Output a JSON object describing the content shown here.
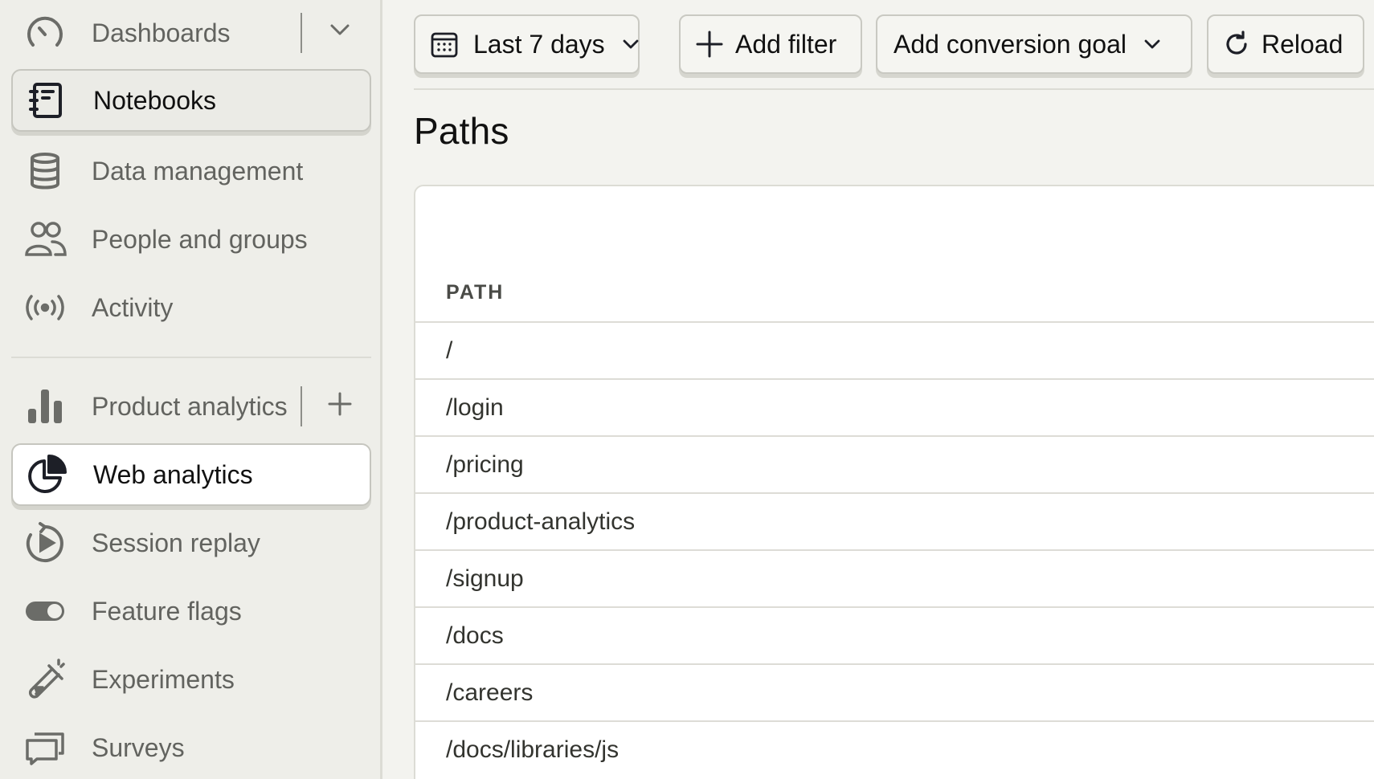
{
  "sidebar": {
    "items": [
      {
        "label": "Dashboards",
        "icon": "gauge-icon"
      },
      {
        "label": "Notebooks",
        "icon": "notebook-icon"
      },
      {
        "label": "Data management",
        "icon": "database-icon"
      },
      {
        "label": "People and groups",
        "icon": "people-icon"
      },
      {
        "label": "Activity",
        "icon": "broadcast-icon"
      },
      {
        "label": "Product analytics",
        "icon": "bar-chart-icon"
      },
      {
        "label": "Web analytics",
        "icon": "pie-chart-icon"
      },
      {
        "label": "Session replay",
        "icon": "replay-icon"
      },
      {
        "label": "Feature flags",
        "icon": "toggle-icon"
      },
      {
        "label": "Experiments",
        "icon": "flask-icon"
      },
      {
        "label": "Surveys",
        "icon": "chat-bubbles-icon"
      }
    ]
  },
  "toolbar": {
    "date_range_label": "Last 7 days",
    "add_filter_label": "Add filter",
    "conversion_goal_label": "Add conversion goal",
    "reload_label": "Reload"
  },
  "page": {
    "title": "Paths"
  },
  "table": {
    "column_header": "PATH",
    "rows": [
      "/",
      "/login",
      "/pricing",
      "/product-analytics",
      "/signup",
      "/docs",
      "/careers",
      "/docs/libraries/js"
    ]
  },
  "colors": {
    "sidebar_bg": "#eeeee9",
    "page_bg": "#f3f3ef",
    "card_bg": "#ffffff",
    "border": "#c9c9c2",
    "text": "#1d1f27",
    "muted_text": "#62635f"
  }
}
